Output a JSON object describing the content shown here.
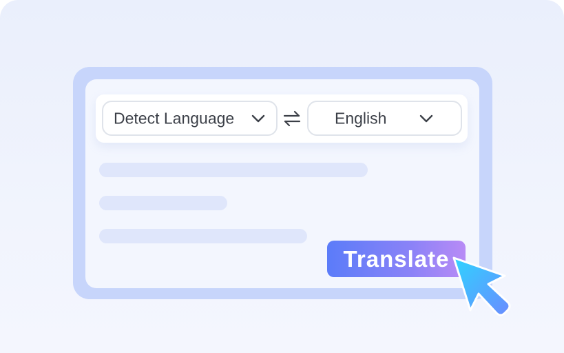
{
  "languages": {
    "source_label": "Detect Language",
    "target_label": "English"
  },
  "icons": {
    "source_dropdown": "chevron-down-icon",
    "target_dropdown": "chevron-down-icon",
    "swap": "swap-arrows-icon",
    "cursor": "pointer-cursor-icon"
  },
  "actions": {
    "translate_label": "Translate"
  },
  "colors": {
    "frame": "#c7d5fb",
    "panel": "#f3f6fe",
    "text_placeholder": "#dfe6fb",
    "button_gradient_start": "#5b7cf9",
    "button_gradient_end": "#b88bf6",
    "cursor_gradient_start": "#2fd3ff",
    "cursor_gradient_end": "#6a8cff"
  }
}
